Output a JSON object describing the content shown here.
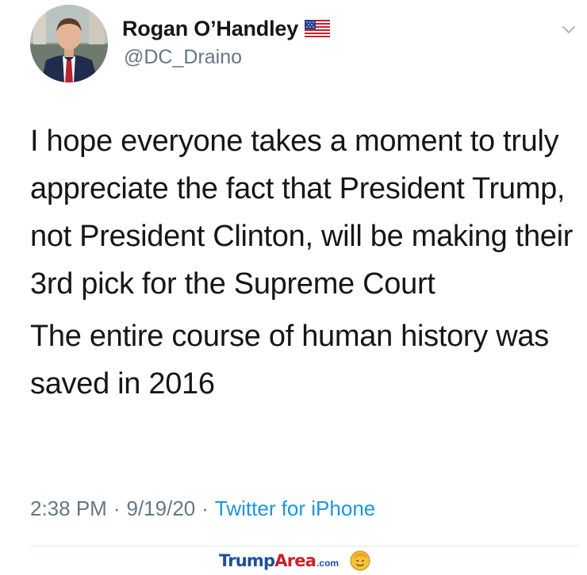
{
  "user": {
    "display_name": "Rogan O’Handley",
    "handle": "@DC_Draino",
    "avatar_icon": "profile-photo",
    "flag_icon": "us-flag-icon"
  },
  "tweet": {
    "paragraph_1": "I hope everyone takes a moment to truly appreciate the fact that President Trump, not President Clinton, will be making their 3rd pick for the Supreme Court",
    "paragraph_2": "The entire course of human history was saved in 2016"
  },
  "meta": {
    "time": "2:38 PM",
    "separator": "·",
    "date": "9/19/20",
    "source": "Twitter for iPhone"
  },
  "watermark": {
    "part_1": "Trump",
    "part_2": "Area",
    "part_3": ".com"
  },
  "colors": {
    "text": "#14171a",
    "secondary": "#657786",
    "link": "#1b95e0",
    "divider": "#e1e8ed"
  }
}
